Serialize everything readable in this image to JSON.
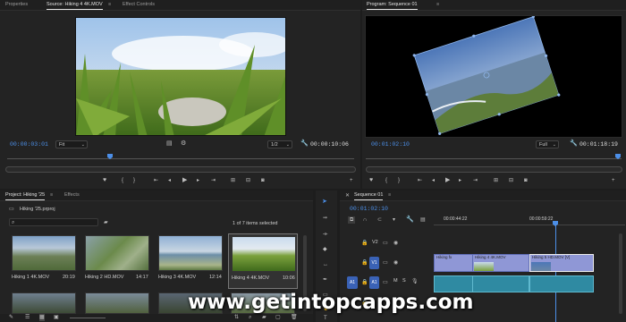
{
  "source": {
    "tabs": [
      "Properties",
      "Source: Hiking 4 4K.MOV",
      "≡",
      "Effect Controls"
    ],
    "timecode_in": "00:00:03:01",
    "fit": "Fit",
    "res": "1/2",
    "timecode_dur": "00:00:10:06"
  },
  "program": {
    "tabs": [
      "Program: Sequence 01",
      "≡"
    ],
    "timecode_in": "00:01:02:10",
    "fit": "Full",
    "timecode_dur": "00:01:18:19"
  },
  "project": {
    "tabs": [
      "Project: Hiking '25",
      "≡",
      "Effects"
    ],
    "file": "Hiking '25.prproj",
    "status": "1 of 7 items selected",
    "clips": [
      {
        "name": "Hiking 1 4K.MOV",
        "dur": "20:19"
      },
      {
        "name": "Hiking 2 HD.MOV",
        "dur": "14:17"
      },
      {
        "name": "Hiking 3 4K.MOV",
        "dur": "12:14"
      },
      {
        "name": "Hiking 4 4K.MOV",
        "dur": "10:06"
      }
    ]
  },
  "sequence": {
    "tab": "Sequence 01",
    "menu": "≡",
    "timecode": "00:01:02:10",
    "ruler": [
      "00:00:44:22",
      "00:00:59:22"
    ],
    "tracks": [
      "V2",
      "V1",
      "A1",
      "A1"
    ],
    "clips": [
      "Hiking 4 4K.MOV",
      "Hiking 5 HD.MOV [V]",
      "Hiking"
    ],
    "fx": "fx"
  },
  "watermark": "www.getintopcapps.com",
  "colors": {
    "accent": "#4c8fe8",
    "video_clip": "#8f97d6",
    "audio_clip": "#2f8aa2"
  }
}
